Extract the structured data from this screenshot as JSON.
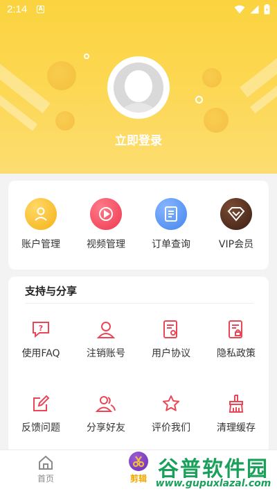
{
  "status_bar": {
    "time": "2:14",
    "notification_glyph": "A",
    "icons": [
      "wifi-icon",
      "signal-icon",
      "battery-icon"
    ]
  },
  "profile": {
    "avatar_icon": "default-avatar-icon",
    "login_label": "立即登录"
  },
  "quick_actions": [
    {
      "label": "账户管理",
      "icon": "account-icon",
      "color": "#f9b820"
    },
    {
      "label": "视频管理",
      "icon": "video-play-icon",
      "color": "#f2455b"
    },
    {
      "label": "订单查询",
      "icon": "order-document-icon",
      "color": "#4f8ef0"
    },
    {
      "label": "VIP会员",
      "icon": "vip-diamond-icon",
      "color": "#4a2a1c"
    }
  ],
  "support": {
    "title": "支持与分享",
    "row1": [
      {
        "label": "使用FAQ",
        "icon": "faq-icon"
      },
      {
        "label": "注销账号",
        "icon": "deregister-user-icon"
      },
      {
        "label": "用户协议",
        "icon": "user-agreement-icon"
      },
      {
        "label": "隐私政策",
        "icon": "privacy-policy-icon"
      }
    ],
    "row2": [
      {
        "label": "反馈问题",
        "icon": "feedback-edit-icon"
      },
      {
        "label": "分享好友",
        "icon": "share-friends-icon"
      },
      {
        "label": "评价我们",
        "icon": "rate-star-icon"
      },
      {
        "label": "清理缓存",
        "icon": "clear-cache-broom-icon"
      }
    ],
    "icon_color": "#e94656"
  },
  "tabbar": {
    "tabs": [
      {
        "label": "首页",
        "icon": "home-icon",
        "active": false
      },
      {
        "label": "剪辑",
        "icon": "scissors-icon",
        "active": true
      }
    ],
    "active_color": "#f2a900",
    "inactive_color": "#8a8a8a"
  },
  "watermark": {
    "title": "谷普软件园",
    "url": "www.gupuxlazal.com"
  }
}
